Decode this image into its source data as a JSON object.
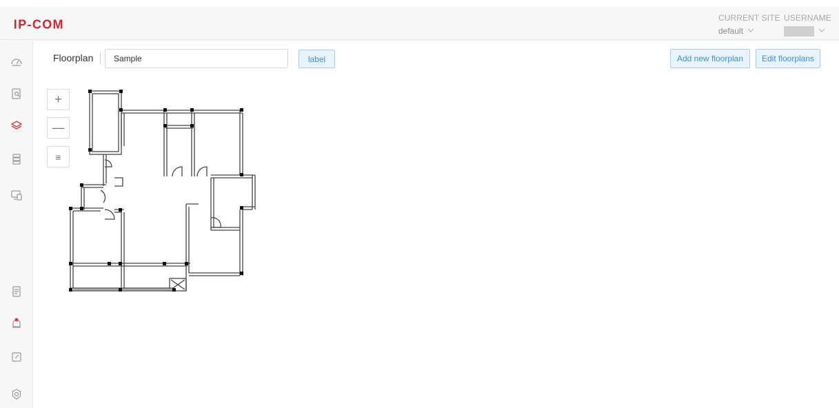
{
  "header": {
    "logo_text": "IP-COM",
    "current_site_label": "CURRENT SITE",
    "current_site_value": "default",
    "username_label": "USERNAME",
    "username_value": ""
  },
  "sidebar": {
    "items": [
      {
        "icon": "dashboard-gauge-icon"
      },
      {
        "icon": "site-search-icon"
      },
      {
        "icon": "layers-floorplan-icon",
        "active": true
      },
      {
        "icon": "device-stack-icon"
      },
      {
        "icon": "client-devices-icon"
      },
      {
        "icon": "logs-document-icon"
      },
      {
        "icon": "alarm-bell-icon"
      },
      {
        "icon": "edit-note-icon"
      },
      {
        "icon": "settings-gear-icon"
      }
    ]
  },
  "toolbar": {
    "floorplan_label": "Floorplan",
    "floorplan_value": "Sample",
    "label_button": "label",
    "add_button": "Add new floorplan",
    "edit_button": "Edit floorplans"
  },
  "map_controls": {
    "zoom_in": "+",
    "zoom_out": "—",
    "list": "≡"
  },
  "colors": {
    "brand_red": "#d9232d",
    "accent_blue": "#3d8fe0",
    "accent_blue_bg": "#e9f3fd",
    "active_icon_red": "#e23a3a"
  }
}
